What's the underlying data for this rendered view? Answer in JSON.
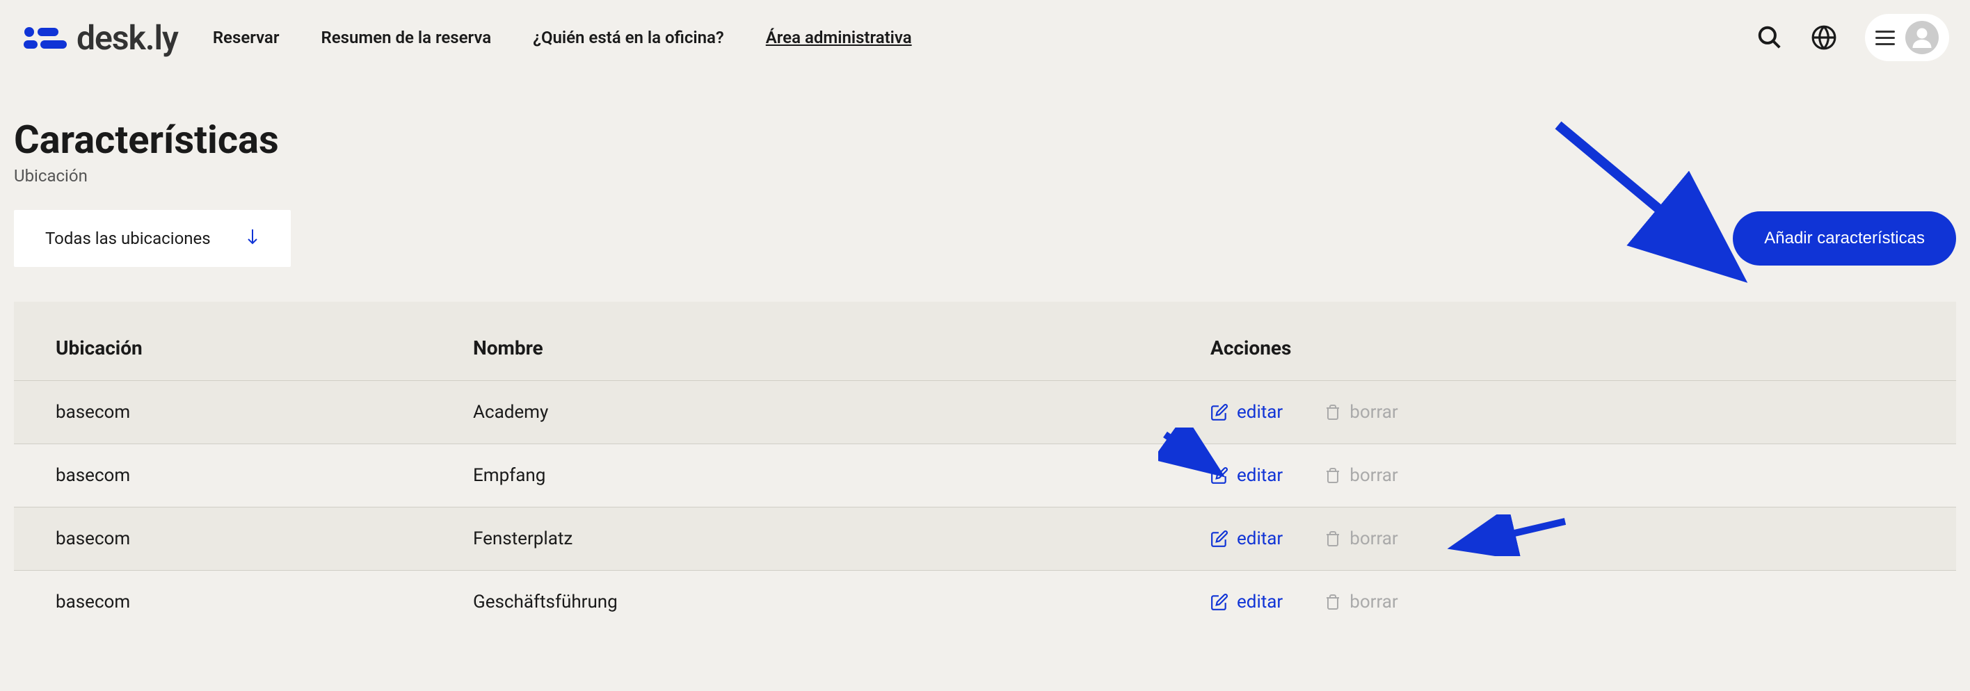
{
  "brand": {
    "name": "desk.ly"
  },
  "nav": {
    "items": [
      {
        "label": "Reservar",
        "active": false
      },
      {
        "label": "Resumen de la reserva",
        "active": false
      },
      {
        "label": "¿Quién está en la oficina?",
        "active": false
      },
      {
        "label": "Área administrativa",
        "active": true
      }
    ]
  },
  "page": {
    "title": "Características",
    "subtitle": "Ubicación"
  },
  "filter": {
    "dropdown_label": "Todas las ubicaciones"
  },
  "actions": {
    "add_button": "Añadir características",
    "edit_label": "editar",
    "delete_label": "borrar"
  },
  "table": {
    "headers": {
      "location": "Ubicación",
      "name": "Nombre",
      "actions": "Acciones"
    },
    "rows": [
      {
        "location": "basecom",
        "name": "Academy"
      },
      {
        "location": "basecom",
        "name": "Empfang"
      },
      {
        "location": "basecom",
        "name": "Fensterplatz"
      },
      {
        "location": "basecom",
        "name": "Geschäftsführung"
      }
    ]
  }
}
